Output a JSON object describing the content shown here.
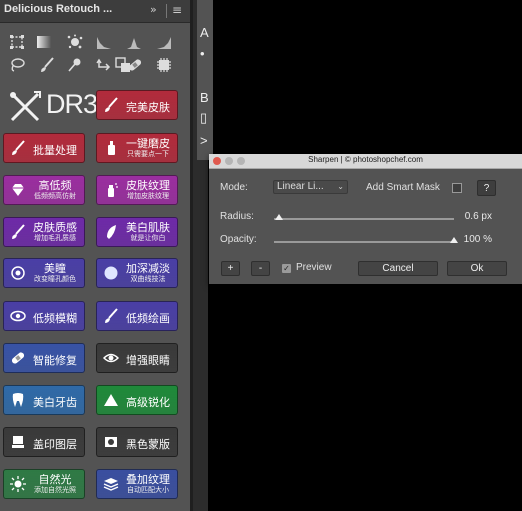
{
  "panel": {
    "title": "Delicious Retouch ...",
    "collapse_glyph": "»",
    "menu_glyph": "≡",
    "tools_row1": [
      "marquee-icon",
      "gradient-icon",
      "splatter-brush-icon",
      "histogram-low-icon",
      "histogram-mid-icon",
      "histogram-high-icon"
    ],
    "tools_row2": [
      "lasso-icon",
      "brush-icon",
      "pin-icon",
      "swap-icon",
      "copy-icon",
      "bandage-icon",
      "chip-icon"
    ],
    "logo_text": "DR3",
    "buttons": [
      {
        "id": "perfect-skin",
        "main": "完美皮肤",
        "sub": "",
        "color": "#b22b3c",
        "icon": "brush-icon"
      },
      {
        "id": "batch",
        "main": "批量处理",
        "sub": "",
        "color": "#b22b3c",
        "icon": "brush-icon"
      },
      {
        "id": "one-click",
        "main": "一键磨皮",
        "sub": "只需要点一下",
        "color": "#b22b3c",
        "icon": "bottle-icon"
      },
      {
        "id": "hi-lo-freq",
        "main": "高低频",
        "sub": "低频频高仿射",
        "color": "#9b2ea0",
        "icon": "diamond-icon"
      },
      {
        "id": "skin-texture",
        "main": "皮肤纹理",
        "sub": "增加皮肤纹理",
        "color": "#9b2ea0",
        "icon": "spray-icon"
      },
      {
        "id": "skin-quality",
        "main": "皮肤质感",
        "sub": "增加毛孔质感",
        "color": "#6e2aa8",
        "icon": "brush-icon"
      },
      {
        "id": "whiten-skin",
        "main": "美白肌肤",
        "sub": "就是让你白",
        "color": "#6e2aa8",
        "icon": "feather-icon"
      },
      {
        "id": "pupil",
        "main": "美瞳",
        "sub": "改变瞳孔颜色",
        "color": "#4a3fa6",
        "icon": "eye-ring-icon"
      },
      {
        "id": "deepen",
        "main": "加深减淡",
        "sub": "双曲线技法",
        "color": "#4a3fa6",
        "icon": "circle-icon"
      },
      {
        "id": "low-blur",
        "main": "低频模糊",
        "sub": "",
        "color": "#4a3fa6",
        "icon": "eye-blur-icon"
      },
      {
        "id": "low-paint",
        "main": "低频绘画",
        "sub": "",
        "color": "#4a3fa6",
        "icon": "brush-icon"
      },
      {
        "id": "smart-fix",
        "main": "智能修复",
        "sub": "",
        "color": "#3853a6",
        "icon": "bandage-icon"
      },
      {
        "id": "enhance-eyes",
        "main": "增强眼睛",
        "sub": "",
        "color": "#3a3a3a",
        "icon": "eye-icon"
      },
      {
        "id": "whiten-teeth",
        "main": "美白牙齿",
        "sub": "",
        "color": "#2f6aa8",
        "icon": "tooth-icon"
      },
      {
        "id": "sharpen",
        "main": "高级锐化",
        "sub": "",
        "color": "#1f8a3a",
        "icon": "triangle-icon"
      },
      {
        "id": "stamp",
        "main": "盖印图层",
        "sub": "",
        "color": "#3a3a3a",
        "icon": "stamp-icon"
      },
      {
        "id": "black-mask",
        "main": "黑色蒙版",
        "sub": "",
        "color": "#3a3a3a",
        "icon": "mask-icon"
      },
      {
        "id": "natural-light",
        "main": "自然光",
        "sub": "添加自然光照",
        "color": "#2f7a45",
        "icon": "sun-icon"
      },
      {
        "id": "overlay-texture",
        "main": "叠加纹理",
        "sub": "自动匹配大小",
        "color": "#3a4fa0",
        "icon": "layers-icon"
      }
    ]
  },
  "doc_strip_glyphs": [
    "A",
    "•",
    "B",
    "▯",
    ">"
  ],
  "dialog": {
    "title": "Sharpen | © photoshopchef.com",
    "mode_label": "Mode:",
    "mode_value": "Linear Li...",
    "smart_mask_label": "Add Smart Mask",
    "smart_mask_checked": false,
    "help_label": "?",
    "radius_label": "Radius:",
    "radius_value": "0.6 px",
    "radius_fraction": 0.03,
    "opacity_label": "Opacity:",
    "opacity_value": "100 %",
    "opacity_fraction": 1.0,
    "plus_label": "+",
    "minus_label": "-",
    "preview_label": "Preview",
    "preview_checked": true,
    "cancel_label": "Cancel",
    "ok_label": "Ok",
    "traffic_colors": [
      "#e05a4f",
      "#b5b5b5",
      "#b5b5b5"
    ]
  }
}
